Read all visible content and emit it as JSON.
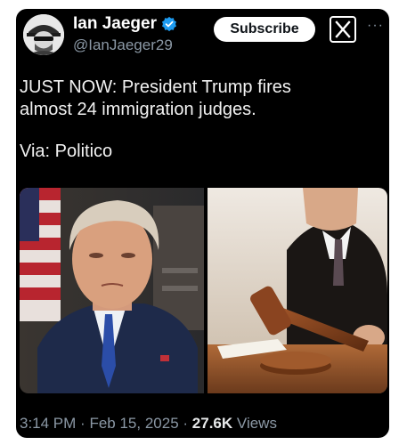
{
  "tweet": {
    "author_name": "Ian Jaeger",
    "author_handle": "@IanJaeger29",
    "subscribe_label": "Subscribe",
    "text_line1": "JUST NOW: President Trump fires",
    "text_line2": "almost 24 immigration judges.",
    "via": "Via: Politico",
    "time": "3:14 PM",
    "date": "Feb 15, 2025",
    "separator": "·",
    "views_count": "27.6K",
    "views_label": "Views"
  },
  "icons": {
    "verified": "verified-badge-icon",
    "x_logo": "x-logo-icon",
    "more": "more-options-icon"
  },
  "colors": {
    "background": "#000000",
    "verified": "#1d9bf0",
    "secondary_text": "#8b98a5"
  }
}
